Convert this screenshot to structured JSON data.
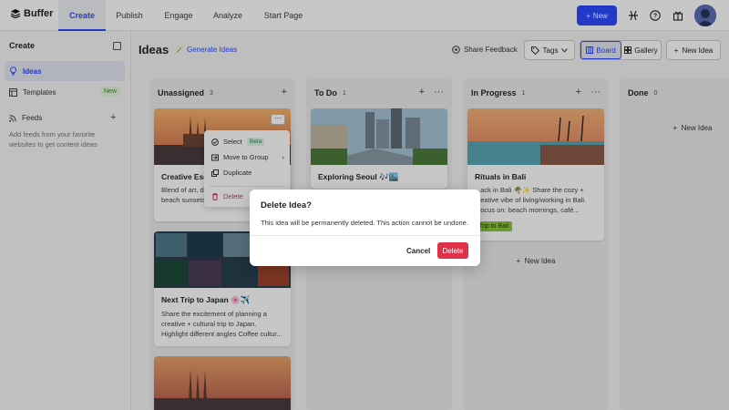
{
  "nav": {
    "brand": "Buffer",
    "tabs": [
      {
        "label": "Create"
      },
      {
        "label": "Publish"
      },
      {
        "label": "Engage"
      },
      {
        "label": "Analyze"
      },
      {
        "label": "Start Page"
      }
    ],
    "new_button": "New"
  },
  "sidebar": {
    "header": "Create",
    "items": [
      {
        "label": "Ideas"
      },
      {
        "label": "Templates",
        "badge": "New"
      }
    ],
    "feeds_label": "Feeds",
    "feeds_description": "Add feeds from your favorite websites to get content ideas"
  },
  "main": {
    "title": "Ideas",
    "generate_label": "Generate Ideas",
    "share_feedback": "Share Feedback",
    "tags_label": "Tags",
    "view_board": "Board",
    "view_gallery": "Gallery",
    "new_idea_label": "New Idea"
  },
  "columns": [
    {
      "name": "Unassigned",
      "count": "3",
      "cards": [
        {
          "title": "Creative Esc",
          "description": "Blend of art, d lifestyle. Focu tapas, beach sunsets. Tone: i"
        },
        {
          "title": "Next Trip to Japan 🌸✈️",
          "description": "Share the excitement of planning a creative + cultural trip to Japan. Highlight different angles Coffee cultur..."
        }
      ]
    },
    {
      "name": "To Do",
      "count": "1",
      "cards": [
        {
          "title": "Exploring Seoul 🎶🏙️"
        }
      ]
    },
    {
      "name": "In Progress",
      "count": "1",
      "cards": [
        {
          "title": "Rituals in Bali",
          "description": "...ack in Bali 🌴✨ Share the cozy + ...eative vibe of living/working in Bali. ...ocus on: beach mornings, café...",
          "tag": "Trip to Bali"
        }
      ],
      "new_idea": "New Idea"
    },
    {
      "name": "Done",
      "count": "0",
      "new_idea": "New Idea"
    }
  ],
  "context_menu": {
    "select": "Select",
    "beta": "Beta",
    "move_to_group": "Move to Group",
    "duplicate": "Duplicate",
    "delete": "Delete"
  },
  "modal": {
    "title": "Delete Idea?",
    "message": "This idea will be permanently deleted. This action cannot be undone.",
    "cancel": "Cancel",
    "delete": "Delete"
  },
  "colors": {
    "accent": "#2c4bff",
    "danger": "#e0304a",
    "tag_green": "#8cc63f"
  }
}
